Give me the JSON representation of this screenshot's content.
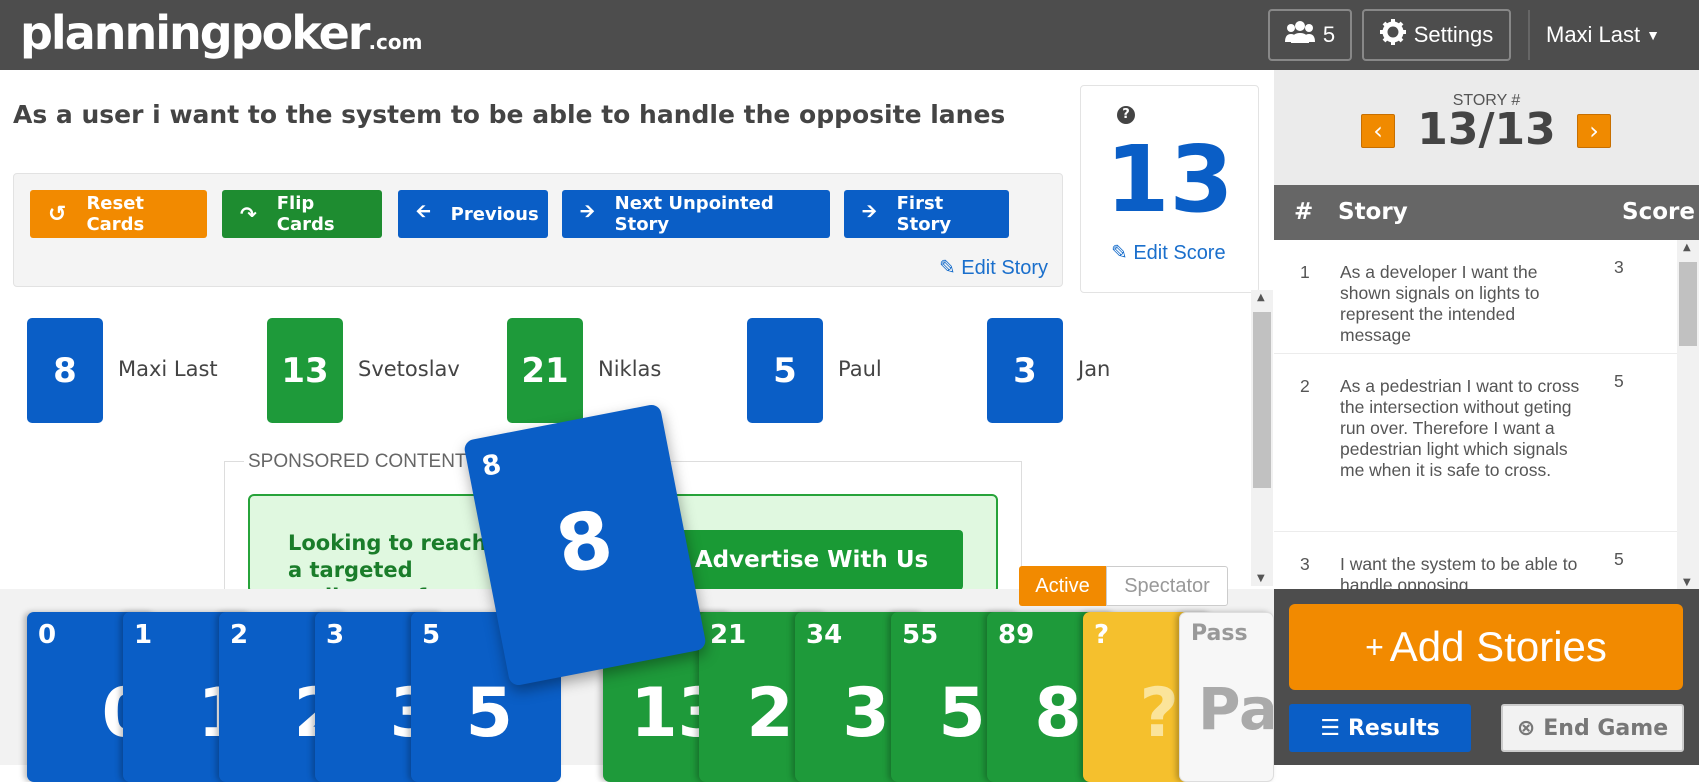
{
  "header": {
    "logo_main": "planningpoker",
    "logo_suffix": ".com",
    "players_count": "5",
    "settings_label": "Settings",
    "user_name": "Maxi Last"
  },
  "story": {
    "title": "As a user i want to the system to be able to handle the opposite lanes",
    "edit_story_label": "Edit Story"
  },
  "actions": {
    "reset": "Reset Cards",
    "flip": "Flip Cards",
    "previous": "Previous",
    "next": "Next Unpointed Story",
    "first": "First Story"
  },
  "score": {
    "value": "13",
    "edit_label": "Edit Score",
    "help": "?"
  },
  "players": [
    {
      "card": "8",
      "name": "Maxi Last",
      "color": "#0a5ec6"
    },
    {
      "card": "13",
      "name": "Svetoslav",
      "color": "#1e9a3a"
    },
    {
      "card": "21",
      "name": "Niklas",
      "color": "#1e9a3a"
    },
    {
      "card": "5",
      "name": "Paul",
      "color": "#0a5ec6"
    },
    {
      "card": "3",
      "name": "Jan",
      "color": "#0a5ec6"
    }
  ],
  "sponsor": {
    "label": "SPONSORED CONTENT",
    "text": "Looking to reach a targeted audience of programmers and tech professionals?",
    "button": "Advertise With Us"
  },
  "mode": {
    "active": "Active",
    "spectator": "Spectator"
  },
  "selected_card": "8",
  "deck": [
    {
      "value": "0",
      "color": "#0a5ec6"
    },
    {
      "value": "1",
      "color": "#0a5ec6"
    },
    {
      "value": "2",
      "color": "#0a5ec6"
    },
    {
      "value": "3",
      "color": "#0a5ec6"
    },
    {
      "value": "5",
      "color": "#0a5ec6"
    },
    {
      "value": "13",
      "color": "#1e9a3a"
    },
    {
      "value": "21",
      "color": "#1e9a3a"
    },
    {
      "value": "34",
      "color": "#1e9a3a"
    },
    {
      "value": "55",
      "color": "#1e9a3a"
    },
    {
      "value": "89",
      "color": "#1e9a3a"
    },
    {
      "value": "?",
      "color": "#f5c02d"
    },
    {
      "value": "Pass",
      "color": "#f7f7f7"
    }
  ],
  "side": {
    "story_num_label": "STORY #",
    "story_num": "13/13",
    "col_num": "#",
    "col_story": "Story",
    "col_score": "Score",
    "stories": [
      {
        "num": "1",
        "text": "As a developer I want the shown signals on lights to represent the intended message",
        "score": "3"
      },
      {
        "num": "2",
        "text": "As a pedestrian I want to cross the intersection without geting run over. Therefore I want a pedestrian light which signals me when it is safe to cross.",
        "score": "5"
      },
      {
        "num": "3",
        "text": "I want the system to be able to handle opposing",
        "score": "5"
      }
    ],
    "add_stories": "Add Stories",
    "results": "Results",
    "end_game": "End Game"
  }
}
